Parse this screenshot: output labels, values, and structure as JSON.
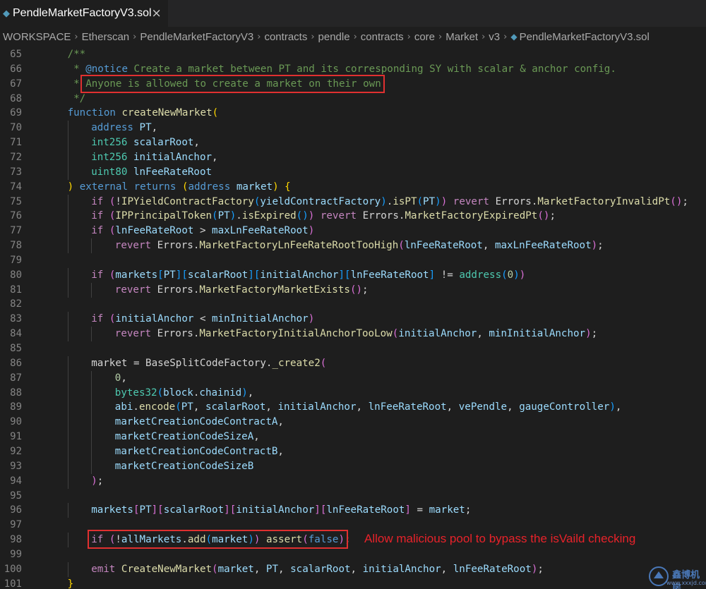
{
  "tab": {
    "title": "PendleMarketFactoryV3.sol",
    "icon": "solidity-file-icon",
    "close": "×"
  },
  "breadcrumb": [
    "WORKSPACE",
    "Etherscan",
    "PendleMarketFactoryV3",
    "contracts",
    "pendle",
    "contracts",
    "core",
    "Market",
    "v3",
    "PendleMarketFactoryV3.sol"
  ],
  "annotation": "Allow malicious pool to bypass the isVaild checking",
  "watermark": {
    "text": "鑫博机房",
    "url": "www.xxxjd.com"
  },
  "colors": {
    "highlight": "#e03030",
    "annotation": "#e8222a",
    "editor_bg": "#1e1e1e"
  },
  "code": [
    {
      "n": "65",
      "indent": 1,
      "tokens": [
        [
          "com",
          "/**"
        ]
      ]
    },
    {
      "n": "66",
      "indent": 1,
      "tokens": [
        [
          "com",
          " * "
        ],
        [
          "doc",
          "@notice"
        ],
        [
          "com",
          " Create a market between PT and its corresponding SY with scalar & anchor config."
        ]
      ]
    },
    {
      "n": "67",
      "indent": 1,
      "tokens": [
        [
          "com",
          " * Anyone is allowed to create a market on their own."
        ]
      ]
    },
    {
      "n": "68",
      "indent": 1,
      "tokens": [
        [
          "com",
          " */"
        ]
      ]
    },
    {
      "n": "69",
      "indent": 1,
      "tokens": [
        [
          "kw",
          "function"
        ],
        [
          "txt",
          " "
        ],
        [
          "fn",
          "createNewMarket"
        ],
        [
          "p1",
          "("
        ]
      ]
    },
    {
      "n": "70",
      "indent": 2,
      "tokens": [
        [
          "kw",
          "address"
        ],
        [
          "txt",
          " "
        ],
        [
          "var",
          "PT"
        ],
        [
          "txt",
          ","
        ]
      ]
    },
    {
      "n": "71",
      "indent": 2,
      "tokens": [
        [
          "type",
          "int256"
        ],
        [
          "txt",
          " "
        ],
        [
          "var",
          "scalarRoot"
        ],
        [
          "txt",
          ","
        ]
      ]
    },
    {
      "n": "72",
      "indent": 2,
      "tokens": [
        [
          "type",
          "int256"
        ],
        [
          "txt",
          " "
        ],
        [
          "var",
          "initialAnchor"
        ],
        [
          "txt",
          ","
        ]
      ]
    },
    {
      "n": "73",
      "indent": 2,
      "tokens": [
        [
          "type",
          "uint80"
        ],
        [
          "txt",
          " "
        ],
        [
          "var",
          "lnFeeRateRoot"
        ]
      ]
    },
    {
      "n": "74",
      "indent": 1,
      "tokens": [
        [
          "p1",
          ")"
        ],
        [
          "txt",
          " "
        ],
        [
          "kw",
          "external"
        ],
        [
          "txt",
          " "
        ],
        [
          "kw",
          "returns"
        ],
        [
          "txt",
          " "
        ],
        [
          "p1",
          "("
        ],
        [
          "kw",
          "address"
        ],
        [
          "txt",
          " "
        ],
        [
          "var",
          "market"
        ],
        [
          "p1",
          ")"
        ],
        [
          "txt",
          " "
        ],
        [
          "p1",
          "{"
        ]
      ]
    },
    {
      "n": "75",
      "indent": 2,
      "tokens": [
        [
          "ctl",
          "if"
        ],
        [
          "txt",
          " "
        ],
        [
          "p2",
          "("
        ],
        [
          "txt",
          "!"
        ],
        [
          "fn",
          "IPYieldContractFactory"
        ],
        [
          "p3",
          "("
        ],
        [
          "var",
          "yieldContractFactory"
        ],
        [
          "p3",
          ")"
        ],
        [
          "txt",
          "."
        ],
        [
          "fn",
          "isPT"
        ],
        [
          "p3",
          "("
        ],
        [
          "var",
          "PT"
        ],
        [
          "p3",
          ")"
        ],
        [
          "p2",
          ")"
        ],
        [
          "txt",
          " "
        ],
        [
          "ctl",
          "revert"
        ],
        [
          "txt",
          " Errors."
        ],
        [
          "fn",
          "MarketFactoryInvalidPt"
        ],
        [
          "p2",
          "()"
        ],
        [
          "txt",
          ";"
        ]
      ]
    },
    {
      "n": "76",
      "indent": 2,
      "tokens": [
        [
          "ctl",
          "if"
        ],
        [
          "txt",
          " "
        ],
        [
          "p2",
          "("
        ],
        [
          "fn",
          "IPPrincipalToken"
        ],
        [
          "p3",
          "("
        ],
        [
          "var",
          "PT"
        ],
        [
          "p3",
          ")"
        ],
        [
          "txt",
          "."
        ],
        [
          "fn",
          "isExpired"
        ],
        [
          "p3",
          "()"
        ],
        [
          "p2",
          ")"
        ],
        [
          "txt",
          " "
        ],
        [
          "ctl",
          "revert"
        ],
        [
          "txt",
          " Errors."
        ],
        [
          "fn",
          "MarketFactoryExpiredPt"
        ],
        [
          "p2",
          "()"
        ],
        [
          "txt",
          ";"
        ]
      ]
    },
    {
      "n": "77",
      "indent": 2,
      "tokens": [
        [
          "ctl",
          "if"
        ],
        [
          "txt",
          " "
        ],
        [
          "p2",
          "("
        ],
        [
          "var",
          "lnFeeRateRoot"
        ],
        [
          "txt",
          " > "
        ],
        [
          "var",
          "maxLnFeeRateRoot"
        ],
        [
          "p2",
          ")"
        ]
      ]
    },
    {
      "n": "78",
      "indent": 3,
      "tokens": [
        [
          "ctl",
          "revert"
        ],
        [
          "txt",
          " Errors."
        ],
        [
          "fn",
          "MarketFactoryLnFeeRateRootTooHigh"
        ],
        [
          "p2",
          "("
        ],
        [
          "var",
          "lnFeeRateRoot"
        ],
        [
          "txt",
          ", "
        ],
        [
          "var",
          "maxLnFeeRateRoot"
        ],
        [
          "p2",
          ")"
        ],
        [
          "txt",
          ";"
        ]
      ]
    },
    {
      "n": "79",
      "indent": 0,
      "tokens": []
    },
    {
      "n": "80",
      "indent": 2,
      "tokens": [
        [
          "ctl",
          "if"
        ],
        [
          "txt",
          " "
        ],
        [
          "p2",
          "("
        ],
        [
          "var",
          "markets"
        ],
        [
          "p3",
          "["
        ],
        [
          "var",
          "PT"
        ],
        [
          "p3",
          "]"
        ],
        [
          "p3",
          "["
        ],
        [
          "var",
          "scalarRoot"
        ],
        [
          "p3",
          "]"
        ],
        [
          "p3",
          "["
        ],
        [
          "var",
          "initialAnchor"
        ],
        [
          "p3",
          "]"
        ],
        [
          "p3",
          "["
        ],
        [
          "var",
          "lnFeeRateRoot"
        ],
        [
          "p3",
          "]"
        ],
        [
          "txt",
          " != "
        ],
        [
          "type",
          "address"
        ],
        [
          "p3",
          "("
        ],
        [
          "num",
          "0"
        ],
        [
          "p3",
          ")"
        ],
        [
          "p2",
          ")"
        ]
      ]
    },
    {
      "n": "81",
      "indent": 3,
      "tokens": [
        [
          "ctl",
          "revert"
        ],
        [
          "txt",
          " Errors."
        ],
        [
          "fn",
          "MarketFactoryMarketExists"
        ],
        [
          "p2",
          "()"
        ],
        [
          "txt",
          ";"
        ]
      ]
    },
    {
      "n": "82",
      "indent": 0,
      "tokens": []
    },
    {
      "n": "83",
      "indent": 2,
      "tokens": [
        [
          "ctl",
          "if"
        ],
        [
          "txt",
          " "
        ],
        [
          "p2",
          "("
        ],
        [
          "var",
          "initialAnchor"
        ],
        [
          "txt",
          " < "
        ],
        [
          "var",
          "minInitialAnchor"
        ],
        [
          "p2",
          ")"
        ]
      ]
    },
    {
      "n": "84",
      "indent": 3,
      "tokens": [
        [
          "ctl",
          "revert"
        ],
        [
          "txt",
          " Errors."
        ],
        [
          "fn",
          "MarketFactoryInitialAnchorTooLow"
        ],
        [
          "p2",
          "("
        ],
        [
          "var",
          "initialAnchor"
        ],
        [
          "txt",
          ", "
        ],
        [
          "var",
          "minInitialAnchor"
        ],
        [
          "p2",
          ")"
        ],
        [
          "txt",
          ";"
        ]
      ]
    },
    {
      "n": "85",
      "indent": 0,
      "tokens": []
    },
    {
      "n": "86",
      "indent": 2,
      "tokens": [
        [
          "txt",
          "market = BaseSplitCodeFactory."
        ],
        [
          "fn",
          "_create2"
        ],
        [
          "p2",
          "("
        ]
      ]
    },
    {
      "n": "87",
      "indent": 3,
      "tokens": [
        [
          "num",
          "0"
        ],
        [
          "txt",
          ","
        ]
      ]
    },
    {
      "n": "88",
      "indent": 3,
      "tokens": [
        [
          "type",
          "bytes32"
        ],
        [
          "p3",
          "("
        ],
        [
          "var",
          "block"
        ],
        [
          "txt",
          "."
        ],
        [
          "var",
          "chainid"
        ],
        [
          "p3",
          ")"
        ],
        [
          "txt",
          ","
        ]
      ]
    },
    {
      "n": "89",
      "indent": 3,
      "tokens": [
        [
          "var",
          "abi"
        ],
        [
          "txt",
          "."
        ],
        [
          "fn",
          "encode"
        ],
        [
          "p3",
          "("
        ],
        [
          "var",
          "PT"
        ],
        [
          "txt",
          ", "
        ],
        [
          "var",
          "scalarRoot"
        ],
        [
          "txt",
          ", "
        ],
        [
          "var",
          "initialAnchor"
        ],
        [
          "txt",
          ", "
        ],
        [
          "var",
          "lnFeeRateRoot"
        ],
        [
          "txt",
          ", "
        ],
        [
          "var",
          "vePendle"
        ],
        [
          "txt",
          ", "
        ],
        [
          "var",
          "gaugeController"
        ],
        [
          "p3",
          ")"
        ],
        [
          "txt",
          ","
        ]
      ]
    },
    {
      "n": "90",
      "indent": 3,
      "tokens": [
        [
          "var",
          "marketCreationCodeContractA"
        ],
        [
          "txt",
          ","
        ]
      ]
    },
    {
      "n": "91",
      "indent": 3,
      "tokens": [
        [
          "var",
          "marketCreationCodeSizeA"
        ],
        [
          "txt",
          ","
        ]
      ]
    },
    {
      "n": "92",
      "indent": 3,
      "tokens": [
        [
          "var",
          "marketCreationCodeContractB"
        ],
        [
          "txt",
          ","
        ]
      ]
    },
    {
      "n": "93",
      "indent": 3,
      "tokens": [
        [
          "var",
          "marketCreationCodeSizeB"
        ]
      ]
    },
    {
      "n": "94",
      "indent": 2,
      "tokens": [
        [
          "p2",
          ")"
        ],
        [
          "txt",
          ";"
        ]
      ]
    },
    {
      "n": "95",
      "indent": 0,
      "tokens": []
    },
    {
      "n": "96",
      "indent": 2,
      "tokens": [
        [
          "var",
          "markets"
        ],
        [
          "p2",
          "["
        ],
        [
          "var",
          "PT"
        ],
        [
          "p2",
          "]"
        ],
        [
          "p2",
          "["
        ],
        [
          "var",
          "scalarRoot"
        ],
        [
          "p2",
          "]"
        ],
        [
          "p2",
          "["
        ],
        [
          "var",
          "initialAnchor"
        ],
        [
          "p2",
          "]"
        ],
        [
          "p2",
          "["
        ],
        [
          "var",
          "lnFeeRateRoot"
        ],
        [
          "p2",
          "]"
        ],
        [
          "txt",
          " = "
        ],
        [
          "var",
          "market"
        ],
        [
          "txt",
          ";"
        ]
      ]
    },
    {
      "n": "97",
      "indent": 0,
      "tokens": []
    },
    {
      "n": "98",
      "indent": 2,
      "tokens": [
        [
          "ctl",
          "if"
        ],
        [
          "txt",
          " "
        ],
        [
          "p2",
          "("
        ],
        [
          "txt",
          "!"
        ],
        [
          "var",
          "allMarkets"
        ],
        [
          "txt",
          "."
        ],
        [
          "fn",
          "add"
        ],
        [
          "p3",
          "("
        ],
        [
          "var",
          "market"
        ],
        [
          "p3",
          ")"
        ],
        [
          "p2",
          ")"
        ],
        [
          "txt",
          " "
        ],
        [
          "fn",
          "assert"
        ],
        [
          "p2",
          "("
        ],
        [
          "kw",
          "false"
        ],
        [
          "p2",
          ")"
        ],
        [
          "txt",
          ";"
        ]
      ]
    },
    {
      "n": "99",
      "indent": 0,
      "tokens": []
    },
    {
      "n": "100",
      "indent": 2,
      "tokens": [
        [
          "ctl",
          "emit"
        ],
        [
          "txt",
          " "
        ],
        [
          "fn",
          "CreateNewMarket"
        ],
        [
          "p2",
          "("
        ],
        [
          "var",
          "market"
        ],
        [
          "txt",
          ", "
        ],
        [
          "var",
          "PT"
        ],
        [
          "txt",
          ", "
        ],
        [
          "var",
          "scalarRoot"
        ],
        [
          "txt",
          ", "
        ],
        [
          "var",
          "initialAnchor"
        ],
        [
          "txt",
          ", "
        ],
        [
          "var",
          "lnFeeRateRoot"
        ],
        [
          "p2",
          ")"
        ],
        [
          "txt",
          ";"
        ]
      ]
    },
    {
      "n": "101",
      "indent": 1,
      "tokens": [
        [
          "p1",
          "}"
        ]
      ]
    }
  ]
}
